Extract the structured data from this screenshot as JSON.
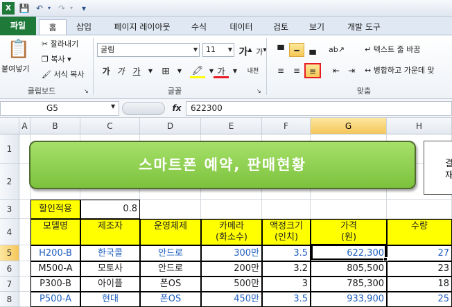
{
  "qat": {
    "dropdown_glyph": "▾"
  },
  "tabs": [
    {
      "label": "파일"
    },
    {
      "label": "홈"
    },
    {
      "label": "삽입"
    },
    {
      "label": "페이지 레이아웃"
    },
    {
      "label": "수식"
    },
    {
      "label": "데이터"
    },
    {
      "label": "검토"
    },
    {
      "label": "보기"
    },
    {
      "label": "개발 도구"
    }
  ],
  "ribbon": {
    "clipboard": {
      "paste": "붙여넣기",
      "cut": "잘라내기",
      "copy": "복사 ▾",
      "format_painter": "서식 복사",
      "label": "클립보드"
    },
    "font": {
      "font_name": "굴림",
      "font_size": "11",
      "grow": "가",
      "shrink": "가",
      "bold": "가",
      "italic": "가",
      "underline": "가",
      "font_color_glyph": "가",
      "phonetic": "내천",
      "label": "글꼴"
    },
    "alignment": {
      "wrap_text": "텍스트 줄 바꿈",
      "merge_center": "병합하고 가운데 맞",
      "label": "맞춤"
    },
    "colors": {
      "accent": "#1f7a3a",
      "highlight": "#f6c856",
      "callout": "#e81c24"
    }
  },
  "formula_bar": {
    "name_box": "G5",
    "fx": "fx",
    "formula": "622300"
  },
  "grid": {
    "columns": [
      "A",
      "B",
      "C",
      "D",
      "E",
      "F",
      "G",
      "H"
    ],
    "rows": [
      "1",
      "2",
      "3",
      "4",
      "5",
      "6",
      "7",
      "8"
    ],
    "title": "스마트폰 예약, 판매현황",
    "side_box": [
      "결",
      "재"
    ],
    "discount_label": "할인적용",
    "discount_value": "0.8",
    "headers": [
      "모델명",
      "제조자",
      "운영체제",
      "카메라\n(화소수)",
      "액정크기\n(인치)",
      "가격\n(원)",
      "수량"
    ],
    "data": [
      [
        "H200-B",
        "한국콜",
        "안드로",
        "300만",
        "3.5",
        "622,300",
        "27"
      ],
      [
        "M500-A",
        "모토사",
        "안드로",
        "200만",
        "3.2",
        "805,500",
        "23"
      ],
      [
        "P300-B",
        "아이플",
        "폰OS",
        "500만",
        "3",
        "785,300",
        "18"
      ],
      [
        "P500-A",
        "현대",
        "폰OS",
        "450만",
        "3.5",
        "933,900",
        "25"
      ]
    ],
    "blue_rows": [
      0,
      3
    ]
  }
}
